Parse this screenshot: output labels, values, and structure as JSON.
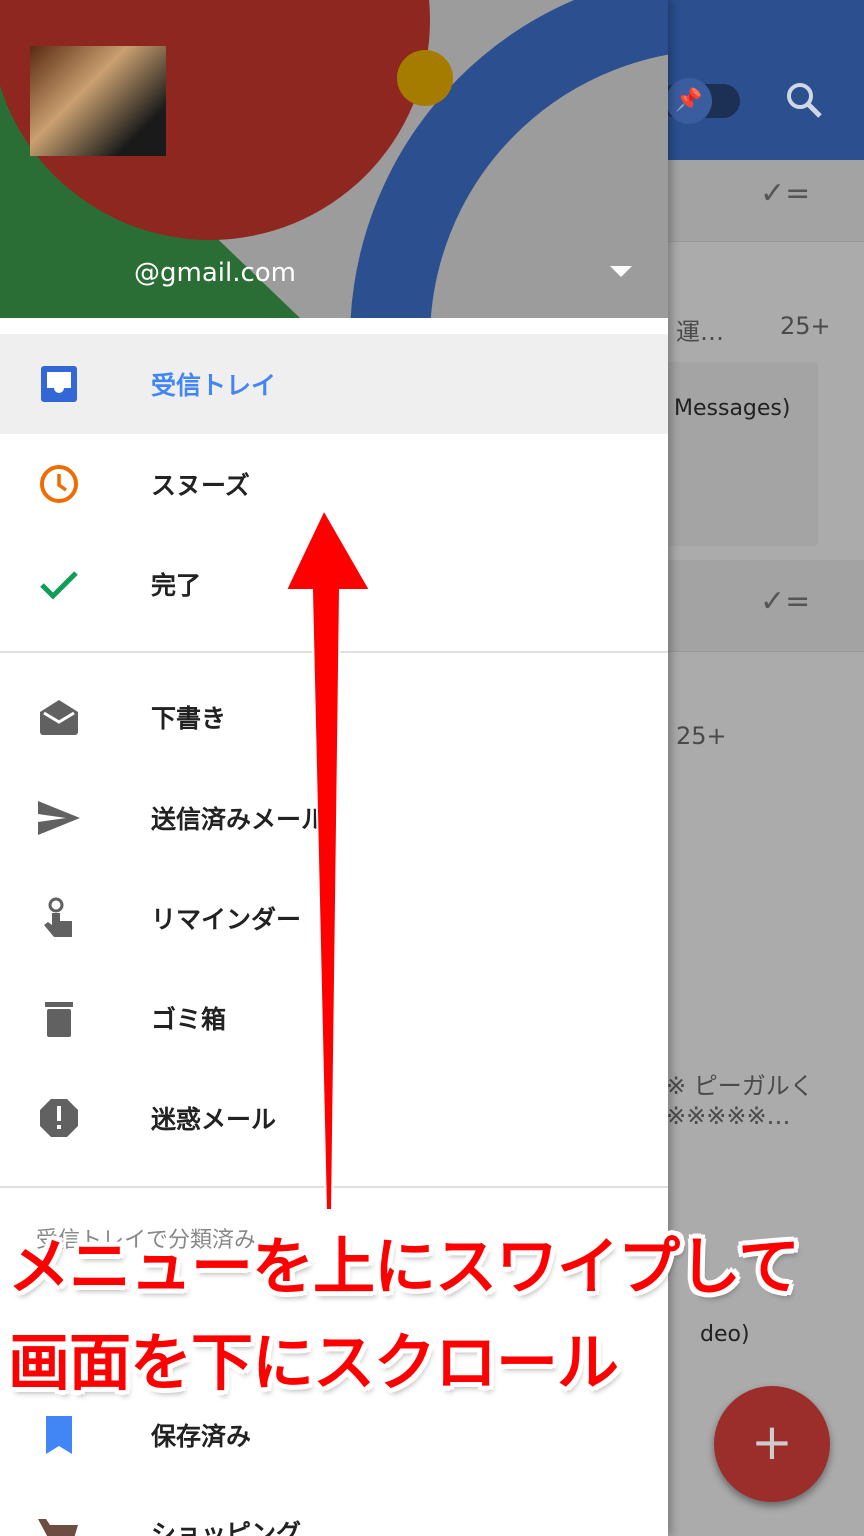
{
  "account": {
    "email": "@gmail.com"
  },
  "drawer": {
    "primary": [
      {
        "label": "受信トレイ",
        "icon": "inbox-icon",
        "selected": true
      },
      {
        "label": "スヌーズ",
        "icon": "clock-icon"
      },
      {
        "label": "完了",
        "icon": "check-icon"
      }
    ],
    "secondary": [
      {
        "label": "下書き",
        "icon": "drafts-icon"
      },
      {
        "label": "送信済みメール",
        "icon": "send-icon"
      },
      {
        "label": "リマインダー",
        "icon": "reminder-icon"
      },
      {
        "label": "ゴミ箱",
        "icon": "trash-icon"
      },
      {
        "label": "迷惑メール",
        "icon": "spam-icon"
      }
    ],
    "section_title": "受信トレイで分類済み",
    "bundles": [
      {
        "label": "保存済み",
        "icon": "bookmark-icon"
      },
      {
        "label": "ショッピング",
        "icon": "cart-icon"
      }
    ]
  },
  "background": {
    "snippet1": "運…",
    "count1": "25+",
    "snippet2": "Messages)",
    "count2": "25+",
    "snippet3": "※ ピーガルく",
    "snippet4": "※※※※※…",
    "snippet5": "deo)"
  },
  "overlay": {
    "line1": "メニューを上にスワイプして",
    "line2": "画面を下にスクロール"
  },
  "colors": {
    "accent": "#4285f4",
    "overlay": "#ff0000",
    "fab": "#9b2d2a"
  }
}
